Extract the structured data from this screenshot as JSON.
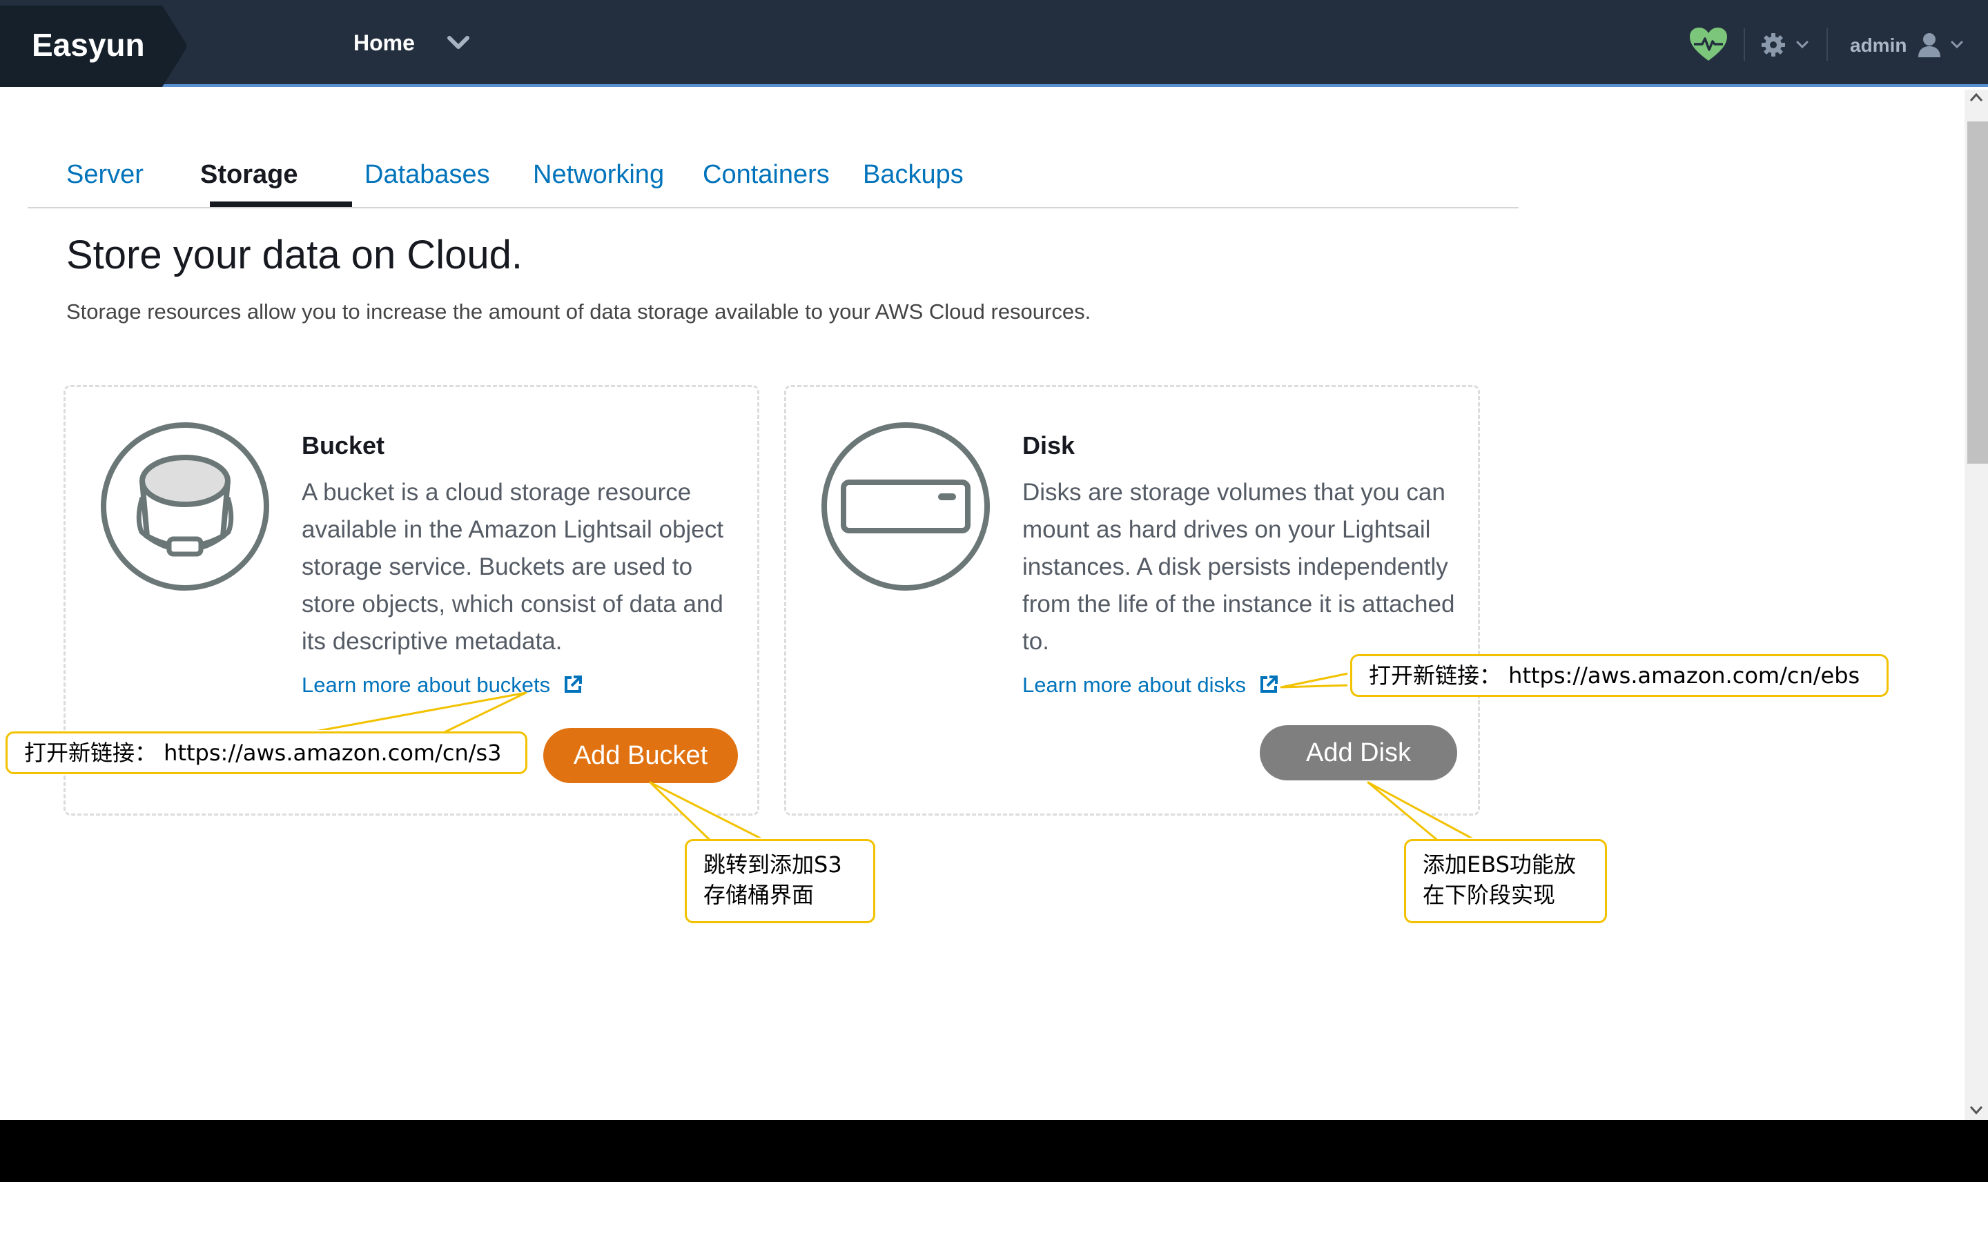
{
  "app": {
    "brand": "Easyun"
  },
  "topbar": {
    "nav_home": "Home",
    "user_name": "admin",
    "icons": [
      "chevron-down-icon",
      "heart-monitor-icon",
      "gear-icon",
      "user-icon"
    ],
    "colors": {
      "background": "#232f3e",
      "brand_bg": "#16202b",
      "accent_line": "#5a8fd0",
      "heart": "#7bc67a"
    }
  },
  "tabs": [
    {
      "label": "Server",
      "active": false
    },
    {
      "label": "Storage",
      "active": true
    },
    {
      "label": "Databases",
      "active": false
    },
    {
      "label": "Networking",
      "active": false
    },
    {
      "label": "Containers",
      "active": false
    },
    {
      "label": "Backups",
      "active": false
    }
  ],
  "page": {
    "title": "Store your data on Cloud.",
    "description": "Storage resources allow you to increase the amount of data storage available to your AWS Cloud resources."
  },
  "cards": [
    {
      "title": "Bucket",
      "text": "A bucket is a cloud storage resource available in the Amazon Lightsail object storage service. Buckets are used to store objects, which consist of data and its descriptive metadata.",
      "link": "Learn more about buckets",
      "button": "Add Bucket",
      "button_color": "#e07212",
      "icon": "bucket-icon"
    },
    {
      "title": "Disk",
      "text": "Disks are storage volumes that you can mount as hard drives on your Lightsail instances. A disk persists independently from the life of the instance it is attached to.",
      "link": "Learn more about disks",
      "button": "Add Disk",
      "button_color": "#7f7f7f",
      "icon": "disk-icon"
    }
  ],
  "annotations": {
    "s3_link": "打开新链接：  https://aws.amazon.com/cn/s3",
    "ebs_link": "打开新链接：  https://aws.amazon.com/cn/ebs",
    "add_bucket_lines": [
      "跳转到添加S3",
      "存储桶界面"
    ],
    "add_disk_lines": [
      "添加EBS功能放",
      "在下阶段实现"
    ],
    "border_color": "#f2c200"
  }
}
